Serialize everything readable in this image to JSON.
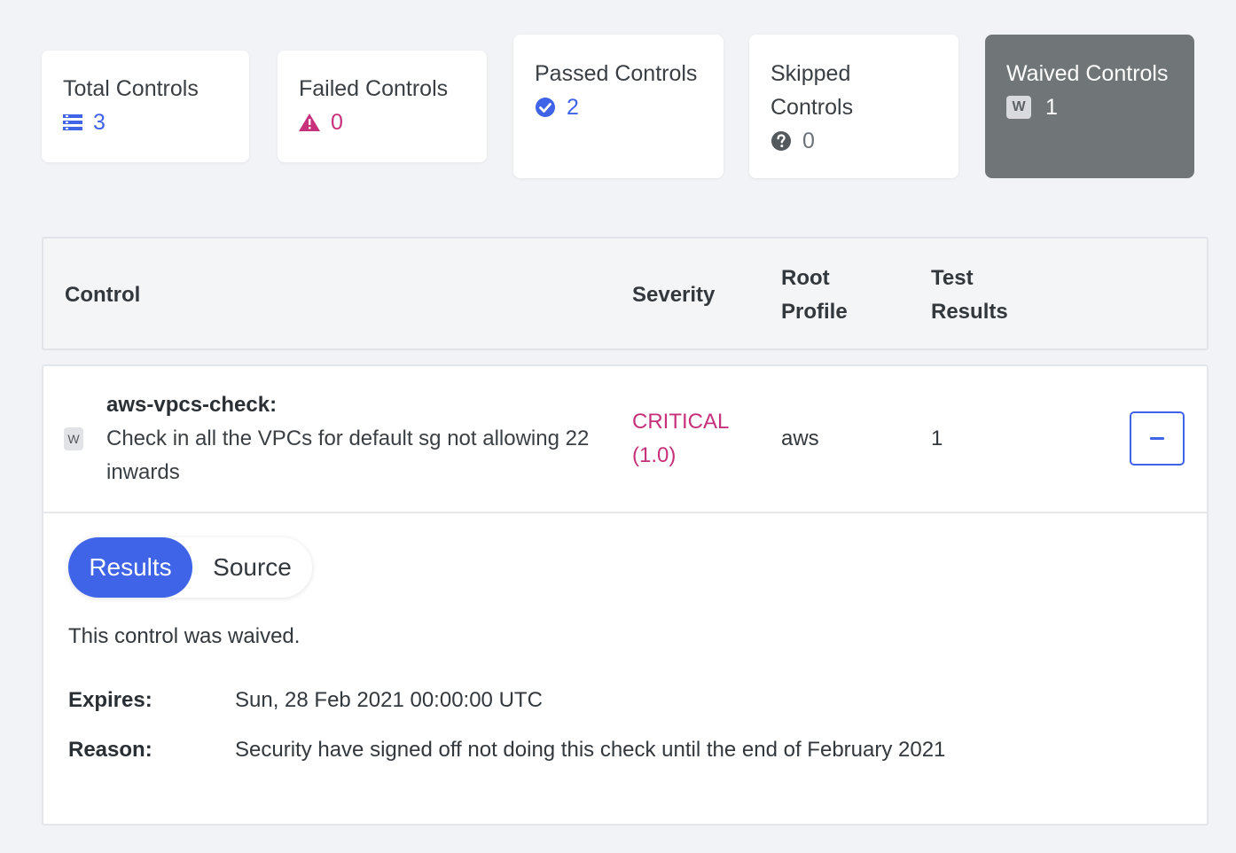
{
  "summary": {
    "total": {
      "label": "Total Controls",
      "count": "3"
    },
    "failed": {
      "label": "Failed Controls",
      "count": "0"
    },
    "passed": {
      "label": "Passed Controls",
      "count": "2"
    },
    "skipped": {
      "label": "Skipped Controls",
      "count": "0"
    },
    "waived": {
      "label": "Waived Controls",
      "count": "1",
      "badge": "W"
    }
  },
  "table": {
    "headers": {
      "control": "Control",
      "severity": "Severity",
      "root_profile": "Root Profile",
      "test_results": "Test Results"
    },
    "row": {
      "badge": "W",
      "control_id": "aws-vpcs-check:",
      "control_desc": "Check in all the VPCs for default sg not allowing 22 inwards",
      "severity": "CRITICAL (1.0)",
      "root_profile": "aws",
      "test_results": "1"
    }
  },
  "detail": {
    "tabs": {
      "results": "Results",
      "source": "Source"
    },
    "message": "This control was waived.",
    "expires_label": "Expires:",
    "expires_value": "Sun, 28 Feb 2021 00:00:00 UTC",
    "reason_label": "Reason:",
    "reason_value": "Security have signed off not doing this check until the end of February 2021"
  },
  "colors": {
    "accent": "#3f64e8",
    "critical": "#c7307a",
    "waived_card": "#707578"
  },
  "icons": {
    "total": "list-icon",
    "failed": "warning-triangle-icon",
    "passed": "check-circle-icon",
    "skipped": "question-circle-icon",
    "waived": "waived-badge-icon",
    "collapse": "minus-icon"
  }
}
